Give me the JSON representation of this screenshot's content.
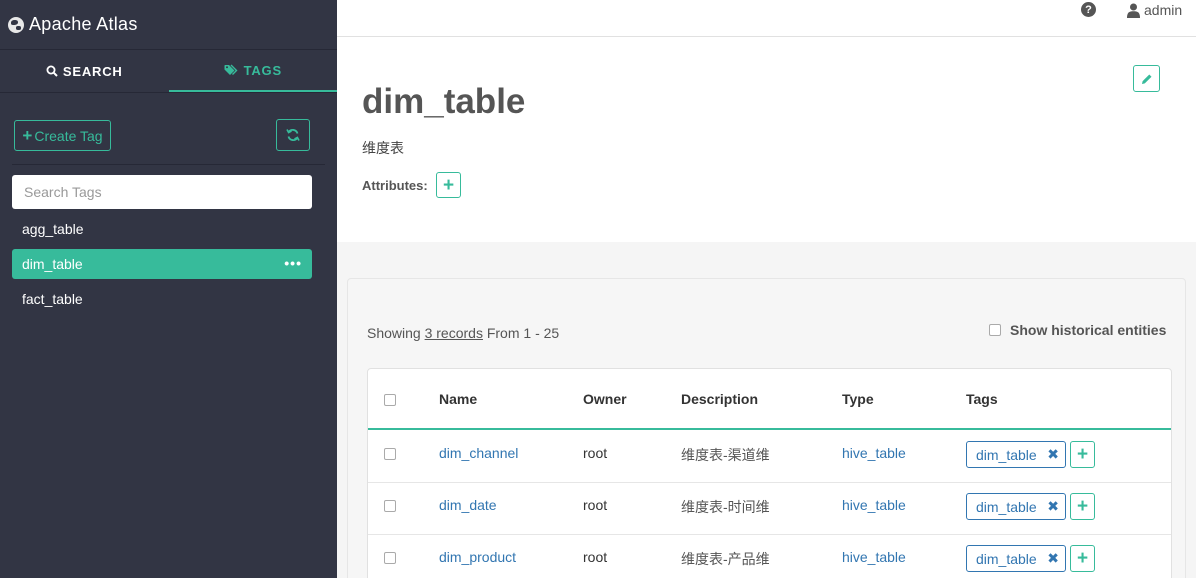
{
  "app": {
    "brand": "Apache Atlas"
  },
  "sidebar": {
    "tabs": [
      {
        "label": "SEARCH",
        "icon": "search-icon",
        "active": false
      },
      {
        "label": "TAGS",
        "icon": "tags-icon",
        "active": true
      }
    ],
    "create_tag_label": "Create Tag",
    "search_placeholder": "Search Tags",
    "tags": [
      {
        "label": "agg_table",
        "active": false
      },
      {
        "label": "dim_table",
        "active": true
      },
      {
        "label": "fact_table",
        "active": false
      }
    ]
  },
  "topbar": {
    "help_icon": "question-circle-icon",
    "user": "admin",
    "user_icon": "user-icon"
  },
  "detail": {
    "title": "dim_table",
    "description": "维度表",
    "attributes_label": "Attributes:"
  },
  "results": {
    "showing_prefix": "Showing",
    "records_link": "3 records",
    "range_text": "From 1 - 25",
    "show_historical_label": "Show historical entities",
    "columns": [
      "Name",
      "Owner",
      "Description",
      "Type",
      "Tags"
    ],
    "rows": [
      {
        "name": "dim_channel",
        "owner": "root",
        "description": "维度表-渠道维",
        "type": "hive_table",
        "tag": "dim_table"
      },
      {
        "name": "dim_date",
        "owner": "root",
        "description": "维度表-时间维",
        "type": "hive_table",
        "tag": "dim_table"
      },
      {
        "name": "dim_product",
        "owner": "root",
        "description": "维度表-产品维",
        "type": "hive_table",
        "tag": "dim_table"
      }
    ]
  },
  "colors": {
    "accent": "#37bb9b",
    "sidebar_bg": "#323544",
    "link": "#3276b1"
  }
}
